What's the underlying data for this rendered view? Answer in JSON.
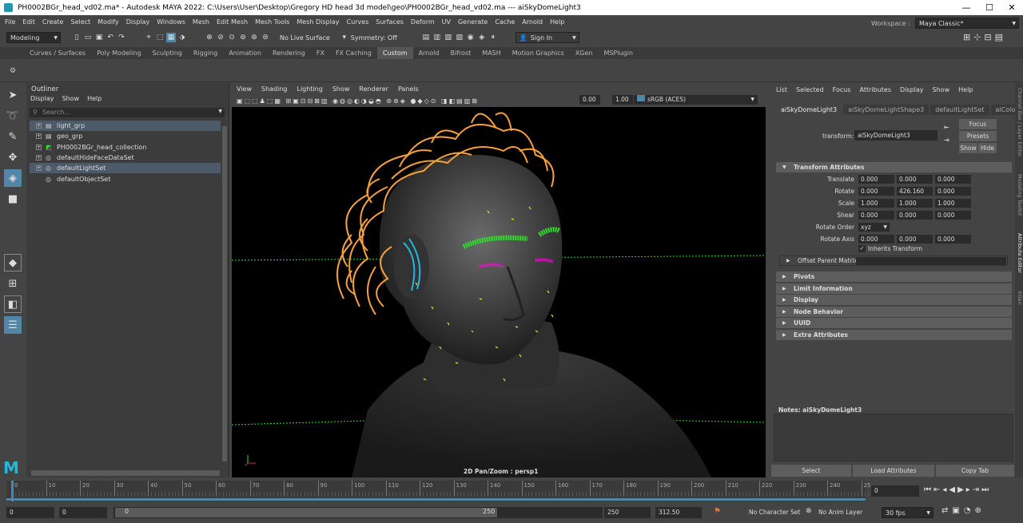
{
  "window": {
    "title": "PH0002BGr_head_vd02.ma* - Autodesk MAYA 2022: C:\\Users\\User\\Desktop\\Gregory HD head 3d model\\geo\\PH0002BGr_head_vd02.ma   ---   aiSkyDomeLight3"
  },
  "menu": [
    "File",
    "Edit",
    "Create",
    "Select",
    "Modify",
    "Display",
    "Windows",
    "Mesh",
    "Edit Mesh",
    "Mesh Tools",
    "Mesh Display",
    "Curves",
    "Surfaces",
    "Deform",
    "UV",
    "Generate",
    "Cache",
    "Arnold",
    "Help"
  ],
  "workspace": {
    "label": "Workspace :",
    "value": "Maya Classic*"
  },
  "status": {
    "mode": "Modeling",
    "live_surface": "No Live Surface",
    "symmetry": "Symmetry: Off",
    "sign_in": "Sign In"
  },
  "shelf_tabs": [
    "Curves / Surfaces",
    "Poly Modeling",
    "Sculpting",
    "Rigging",
    "Animation",
    "Rendering",
    "FX",
    "FX Caching",
    "Custom",
    "Arnold",
    "Bifrost",
    "MASH",
    "Motion Graphics",
    "XGen",
    "MSPlugin"
  ],
  "shelf_active": "Custom",
  "outliner": {
    "title": "Outliner",
    "menu": [
      "Display",
      "Show",
      "Help"
    ],
    "search": "Search...",
    "items": [
      {
        "label": "light_grp"
      },
      {
        "label": "geo_grp"
      },
      {
        "label": "PH0002BGr_head_collection"
      },
      {
        "label": "defaultHideFaceDataSet"
      },
      {
        "label": "defaultLightSet"
      },
      {
        "label": "defaultObjectSet"
      }
    ]
  },
  "viewport": {
    "menu": [
      "View",
      "Shading",
      "Lighting",
      "Show",
      "Renderer",
      "Panels"
    ],
    "exposure": "0.00",
    "gamma": "1.00",
    "colorspace": "sRGB (ACES)",
    "camera_label": "2D Pan/Zoom : persp1"
  },
  "attribute_editor": {
    "menu": [
      "List",
      "Selected",
      "Focus",
      "Attributes",
      "Display",
      "Show",
      "Help"
    ],
    "tabs": [
      "aiSkyDomeLight3",
      "aiSkyDomeLightShape3",
      "defaultLightSet",
      "aiColorC"
    ],
    "transform_label": "transform:",
    "transform_value": "aiSkyDomeLight3",
    "buttons": {
      "focus": "Focus",
      "presets": "Presets",
      "show": "Show",
      "hide": "Hide"
    },
    "section_transform": "Transform Attributes",
    "translate": {
      "label": "Translate",
      "x": "0.000",
      "y": "0.000",
      "z": "0.000"
    },
    "rotate": {
      "label": "Rotate",
      "x": "0.000",
      "y": "426.160",
      "z": "0.000"
    },
    "scale": {
      "label": "Scale",
      "x": "1.000",
      "y": "1.000",
      "z": "1.000"
    },
    "shear": {
      "label": "Shear",
      "x": "0.000",
      "y": "0.000",
      "z": "0.000"
    },
    "rotate_order": {
      "label": "Rotate Order",
      "value": "xyz"
    },
    "rotate_axis": {
      "label": "Rotate Axis",
      "x": "0.000",
      "y": "0.000",
      "z": "0.000"
    },
    "inherits": "Inherits Transform",
    "offset_parent": "Offset Parent Matrix",
    "sections": [
      "Pivots",
      "Limit Information",
      "Display",
      "Node Behavior",
      "UUID",
      "Extra Attributes"
    ],
    "notes": "Notes:  aiSkyDomeLight3",
    "bottom_buttons": [
      "Select",
      "Load Attributes",
      "Copy Tab"
    ],
    "side_tabs": [
      "Channel Box / Layer Editor",
      "Modeling Toolkit",
      "Attribute Editor",
      "XGen"
    ]
  },
  "timeline": {
    "ticks": [
      "0",
      "10",
      "20",
      "30",
      "40",
      "50",
      "60",
      "70",
      "80",
      "90",
      "100",
      "110",
      "120",
      "130",
      "140",
      "150",
      "160",
      "170",
      "180",
      "190",
      "200",
      "210",
      "220",
      "230",
      "240",
      "25"
    ],
    "current": "0"
  },
  "range": {
    "start": "0",
    "start2": "0",
    "slider_start": "0",
    "slider_end": "250",
    "end": "250",
    "end2": "312.50",
    "character": "No Character Set",
    "anim_layer": "No Anim Layer",
    "fps": "30 fps"
  },
  "colors": {
    "accent": "#5285a6",
    "hair": "#f7a13a",
    "brow": "#2ee02a",
    "lash": "#e020c8",
    "cyan": "#22b8e0",
    "grid": "#2ee02a"
  }
}
